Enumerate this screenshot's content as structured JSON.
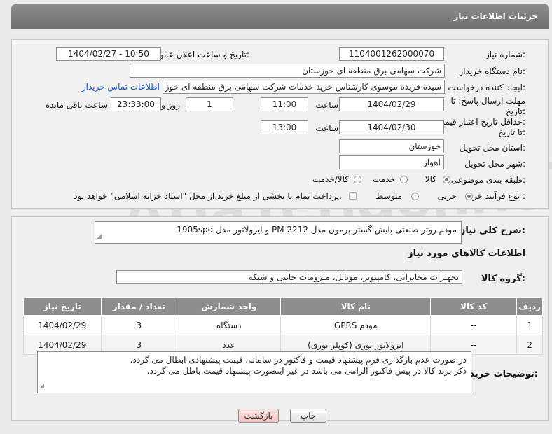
{
  "watermark": "AriaTender.neT",
  "header": {
    "title": "جزئیات اطلاعات نیاز"
  },
  "fields": {
    "need_number_label": "شماره نیاز:",
    "need_number": "1104001262000070",
    "announce_label": "تاریخ و ساعت اعلان عمومی:",
    "announce_value": "1404/02/27 - 10:50",
    "buyer_org_label": "نام دستگاه خریدار:",
    "buyer_org": "شرکت سهامی برق منطقه ای خوزستان",
    "creator_label": "ایجاد کننده درخواست:",
    "creator": "سیده فریده موسوی کارشناس خرید خدمات شرکت سهامی برق منطقه ای خوز",
    "contact_link": "اطلاعات تماس خریدار",
    "reply_deadline_label_1": "مهلت ارسال پاسخ: تا",
    "reply_deadline_label_2": "تاریخ:",
    "reply_date": "1404/02/29",
    "time_label": "ساعت",
    "reply_time": "11:00",
    "days_value": "1",
    "days_label": "روز و",
    "remaining_time": "23:33:00",
    "remaining_label": "ساعت باقی مانده",
    "price_validity_label_1": "حداقل تاریخ اعتبار قیمت:",
    "price_validity_label_2": "تا تاریخ:",
    "price_date": "1404/02/30",
    "price_time": "13:00",
    "province_label": "استان محل تحویل:",
    "province": "خوزستان",
    "city_label": "شهر محل تحویل:",
    "city": "اهواز",
    "category_label": "طبقه بندی موضوعی:",
    "category_options": [
      "کالا",
      "خدمت",
      "کالا/خدمت"
    ],
    "category_selected": "کالا",
    "process_label": "نوع فرآیند خرید :",
    "process_options": [
      "جزیی",
      "متوسط"
    ],
    "process_selected": "جزیی",
    "payment_note": "پرداخت تمام یا بخشی از مبلغ خرید،از محل \"اسناد خزانه اسلامی\" خواهد بود."
  },
  "description": {
    "label": "شرح کلی نیاز:",
    "text": "مودم روتر صنعتی پایش گستر پرمون مدل  PM  2212 و ایزولاتور مدل 1905spd"
  },
  "goods_info": {
    "title": "اطلاعات کالاهای مورد نیاز",
    "group_label": "گروه کالا:",
    "group_value": "تجهیزات مخابراتی، کامپیوتر، موبایل، ملزومات جانبی و شبکه"
  },
  "table": {
    "headers": [
      "ردیف",
      "کد کالا",
      "نام کالا",
      "واحد شمارش",
      "تعداد / مقدار",
      "تاریخ نیاز"
    ],
    "rows": [
      [
        "1",
        "--",
        "مودم GPRS",
        "دستگاه",
        "3",
        "1404/02/29"
      ],
      [
        "2",
        "--",
        "ایزولاتور نوری (کوپلر نوری)",
        "عدد",
        "3",
        "1404/02/29"
      ]
    ]
  },
  "buyer_notes": {
    "label": "توضیحات خریدار:",
    "line1": "در صورت عدم بارگذاری فرم پیشنهاد قیمت و فاکتور در سامانه، قیمت پیشنهادی ابطال می گردد.",
    "line2": "ذکر برند کالا در پیش فاکتور الزامی می باشد در غیر اینصورت پیشنهاد قیمت باطل می گردد."
  },
  "buttons": {
    "print": "چاپ",
    "back": "بازگشت"
  }
}
